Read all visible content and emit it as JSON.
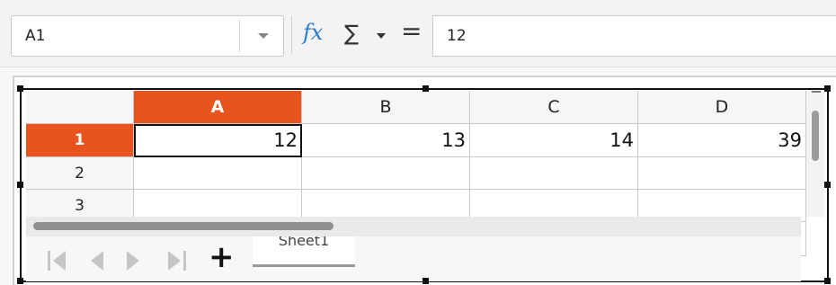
{
  "formula_bar": {
    "name_box": "A1",
    "fx_icon": "fx",
    "sum_icon": "∑",
    "equals_icon": "=",
    "formula_value": "12"
  },
  "sheet": {
    "columns": [
      "A",
      "B",
      "C",
      "D"
    ],
    "rows": [
      "1",
      "2",
      "3"
    ],
    "cells": [
      [
        "12",
        "13",
        "14",
        "39"
      ],
      [
        "",
        "",
        "",
        ""
      ],
      [
        "",
        "",
        "",
        ""
      ]
    ],
    "active_cell": "A1",
    "tab_label": "Sheet1"
  },
  "colors": {
    "accent_header": "#e9541e",
    "fx_blue": "#2a7bd2"
  }
}
